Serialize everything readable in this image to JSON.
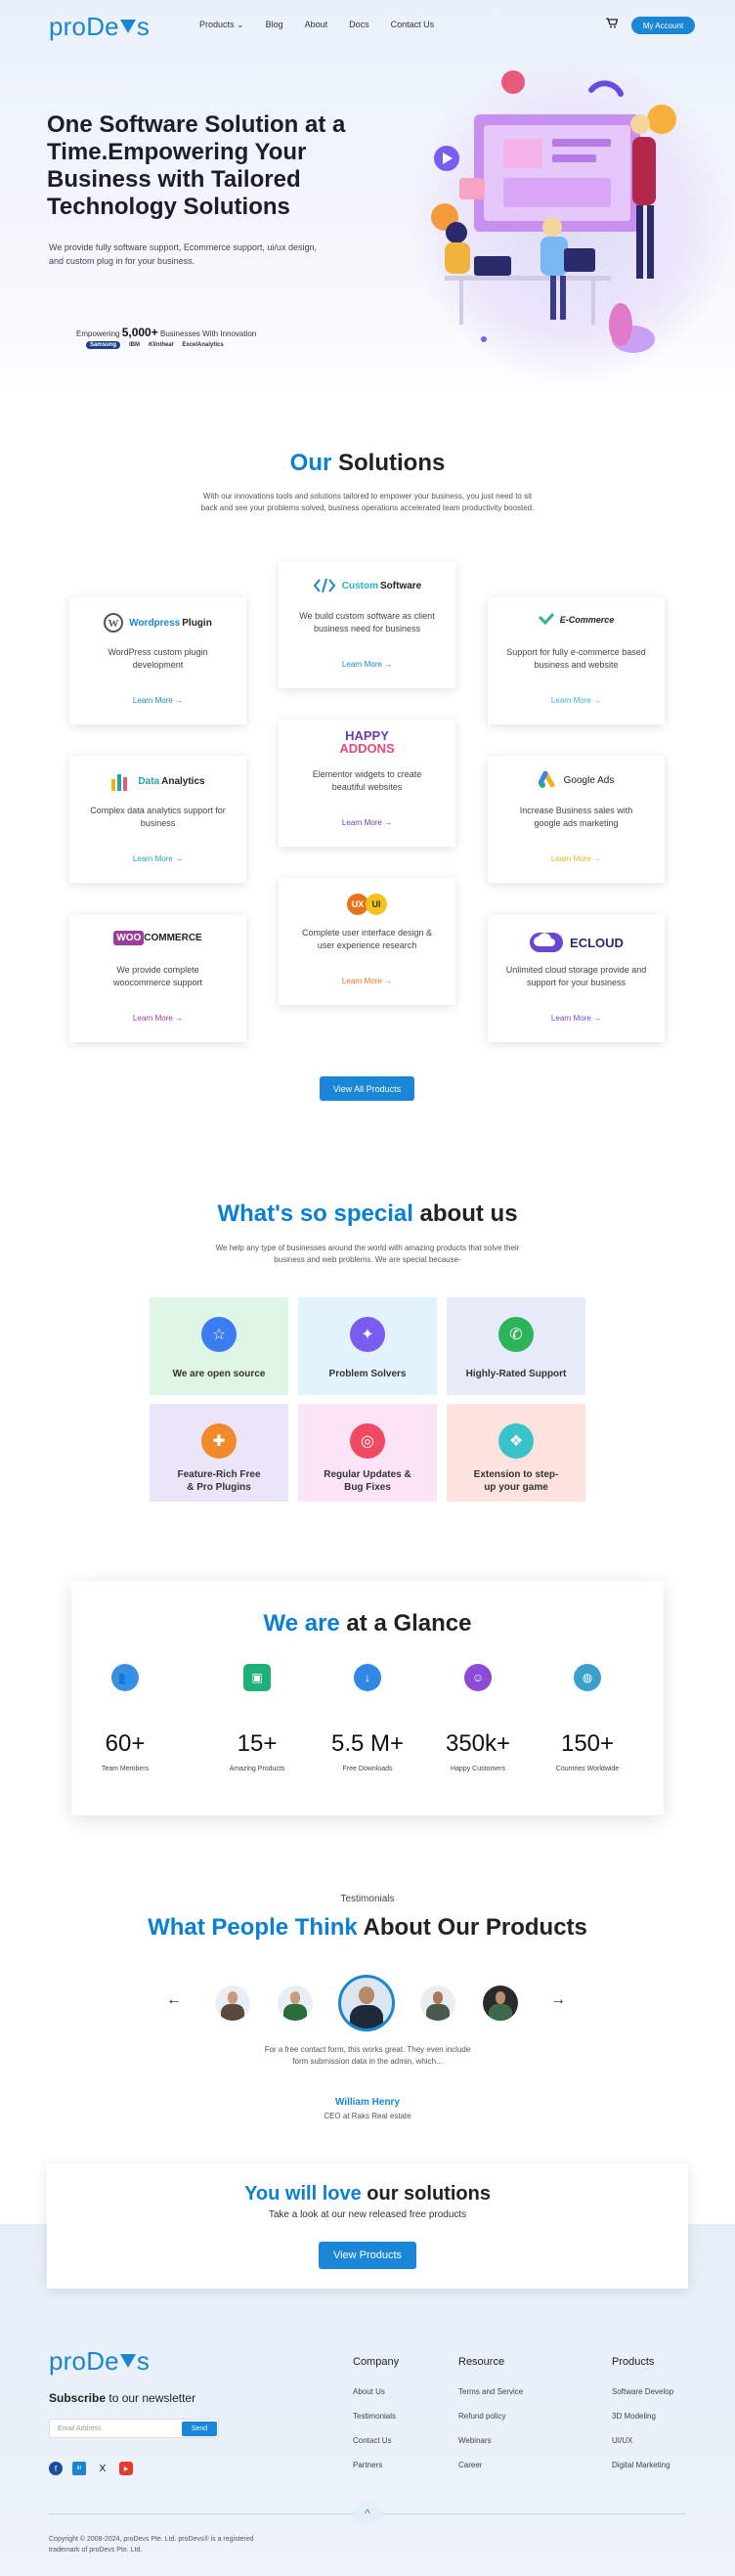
{
  "header": {
    "logo": "proDevs",
    "nav": [
      "Products ⌄",
      "Blog",
      "About",
      "Docs",
      "Contact Us"
    ],
    "cart_icon": "cart-icon",
    "account_label": "My Account"
  },
  "hero": {
    "title": "One Software Solution at a Time.Empowering Your Business with Tailored Technology Solutions",
    "subtitle": "We provide fully software support, Ecommerce support, ui/ux design, and custom plug in for your business.",
    "empower_prefix": "Empowering",
    "empower_count": "5,000+",
    "empower_suffix": "Businesses With Innovation",
    "client_logos": [
      "Samsung",
      "IBM",
      "Klintheal",
      "ExcelAnalytics"
    ]
  },
  "solutions": {
    "title_accent": "Our",
    "title_rest": " Solutions",
    "subtitle": "With our innovations tools and solutions tailored to empower your business, you just need to sit back and see your problems solved, business operations accelerated team productivity boosted.",
    "cards": [
      {
        "name": "Wordpress Plugin",
        "name_accent": "Wordpress",
        "name_rest": " Plugin",
        "desc": "WordPress custom plugin development",
        "link": "Learn More",
        "color": "#1a86cf"
      },
      {
        "name": "Custom Software",
        "name_accent": "Custom",
        "name_rest": " Software",
        "desc": "We build custom software as client business need for business",
        "link": "Learn More",
        "color": "#1a86cf"
      },
      {
        "name": "E-Commerce",
        "name_accent": "",
        "name_rest": "E-Commerce",
        "desc": "Support for fully e-commerce based business and website",
        "link": "Learn More",
        "color": "#35b6d6"
      },
      {
        "name": "Data Analytics",
        "name_accent": "Data",
        "name_rest": " Analytics",
        "desc": "Complex data analytics support for business",
        "link": "Learn More",
        "color": "#22a6a4"
      },
      {
        "name": "Happy Addons",
        "name_accent": "HAPPY",
        "name_rest": " ADDONS",
        "desc": "Elementor widgets to create beautiful websites",
        "link": "Learn More",
        "color": "#6a3ab5"
      },
      {
        "name": "Google Ads",
        "name_accent": "",
        "name_rest": "Google Ads",
        "desc": "Increase Business sales with google ads marketing",
        "link": "Learn More",
        "color": "#f2b318"
      },
      {
        "name": "WooCommerce",
        "name_accent": "WOO",
        "name_rest": "COMMERCE",
        "desc": "We provide complete woocommerce support",
        "link": "Learn More",
        "color": "#9b3b9b"
      },
      {
        "name": "UX UI",
        "name_accent": "UX",
        "name_rest": "UI",
        "desc": "Complete user interface design & user experience research",
        "link": "Learn More",
        "color": "#e8731f"
      },
      {
        "name": "ECLOUD",
        "name_accent": "",
        "name_rest": "ECLOUD",
        "desc": "Unlimited cloud storage provide and support for your business",
        "link": "Learn More",
        "color": "#7a45d6"
      }
    ],
    "view_all": "View All Products"
  },
  "special": {
    "title_accent": "What's so special",
    "title_rest": " about us",
    "subtitle": "We help any type of businesses around the world with amazing products that solve their business and web problems. We are special because-",
    "items": [
      {
        "label": "We are open source",
        "bg": "#dff5e6",
        "icon": "#3b7cf0"
      },
      {
        "label": "Problem Solvers",
        "bg": "#e2f3fb",
        "icon": "#7b5cf0"
      },
      {
        "label": "Highly-Rated Support",
        "bg": "#e7eaf9",
        "icon": "#2db35a"
      },
      {
        "label": "Feature-Rich Free & Pro Plugins",
        "bg": "#ebe5fa",
        "icon": "#f08a2b"
      },
      {
        "label": "Regular Updates & Bug Fixes",
        "bg": "#fbe4f6",
        "icon": "#f04a63"
      },
      {
        "label": "Extension to step-up your game",
        "bg": "#fde3df",
        "icon": "#38c2c9"
      }
    ]
  },
  "glance": {
    "title_accent": "We are",
    "title_rest": " at a Glance",
    "stats": [
      {
        "value": "60+",
        "label": "Team Members",
        "color": "#3b8fe0"
      },
      {
        "value": "15+",
        "label": "Amazing Products",
        "color": "#1fb07a"
      },
      {
        "value": "5.5 M+",
        "label": "Free Downloads",
        "color": "#2f88e5"
      },
      {
        "value": "350k+",
        "label": "Happy Customers",
        "color": "#8b4bd8"
      },
      {
        "value": "150+",
        "label": "Countries Worldwide",
        "color": "#3aa0c9"
      }
    ]
  },
  "testimonials": {
    "eyebrow": "Testimonials",
    "title_accent": "What People Think",
    "title_rest": " About Our Products",
    "quote": "For a free contact form, this works great. They even include form submission data in the admin, which...",
    "name": "William Henry",
    "role": "CEO at Raks Real estate",
    "prev": "←",
    "next": "→"
  },
  "cta": {
    "title_accent": "You will love",
    "title_rest": " our solutions",
    "subtitle": "Take a look at our new released free products",
    "button": "View Products"
  },
  "footer": {
    "logo": "proDevs",
    "subscribe_accent": "Subscribe",
    "subscribe_rest": " to our newsletter",
    "email_placeholder": "Email Address",
    "send": "Send",
    "social": [
      "f",
      "in",
      "X",
      "▶"
    ],
    "columns": [
      {
        "title": "Company",
        "links": [
          "About Us",
          "Testimonials",
          "Contact Us",
          "Partners"
        ]
      },
      {
        "title": "Resource",
        "links": [
          "Terms and Service",
          "Refund policy",
          "Webinars",
          "Career"
        ]
      },
      {
        "title": "Products",
        "links": [
          "Software Develop",
          "3D Modeling",
          "UI/UX",
          "Digital Marketing"
        ]
      }
    ],
    "copyright": "Copyright © 2008-2024, proDevs Pte. Ltd. proDevs® is a registered trademark of proDevs Pte. Ltd.",
    "scroll_top": "^"
  }
}
